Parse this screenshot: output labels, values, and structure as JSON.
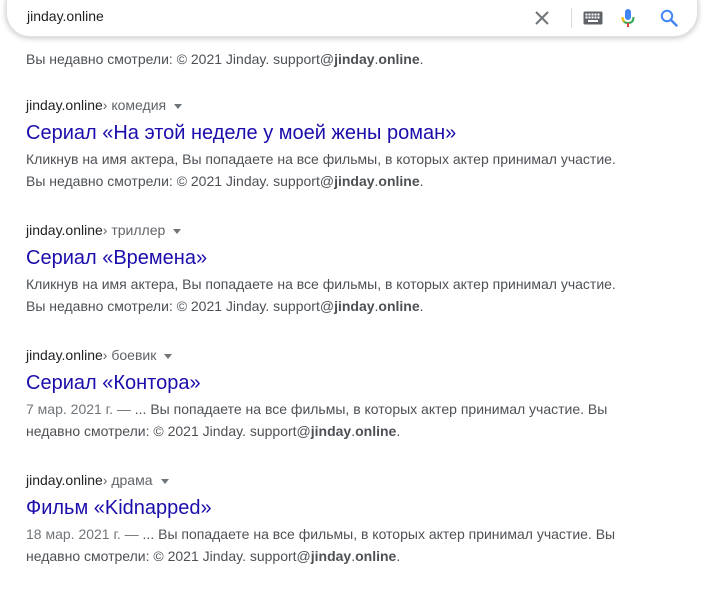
{
  "search": {
    "query": "jinday.online",
    "icons": {
      "clear": "close-icon",
      "keyboard": "keyboard-icon",
      "mic": "microphone-icon",
      "search": "search-icon"
    },
    "colors": {
      "mic_blue": "#4285f4",
      "mic_red": "#ea4335",
      "mic_yellow": "#fbbc04",
      "mic_green": "#34a853",
      "search_blue": "#4285f4"
    }
  },
  "top_snippet": {
    "prefix": "Вы недавно смотрели: © 2021 Jinday. support@",
    "bold1": "jinday",
    "dot": ".",
    "bold2": "online",
    "suffix": "."
  },
  "results": [
    {
      "domain": "jinday.online",
      "path": " › комедия",
      "title": "Сериал «На этой неделе у моей жены роман»",
      "date": "",
      "line1": "Кликнув на имя актера, Вы попадаете на все фильмы, в которых актер принимал участие.",
      "line2_prefix": "Вы недавно смотрели: © 2021 Jinday. support@",
      "bold1": "jinday",
      "dot": ".",
      "bold2": "online",
      "suffix": "."
    },
    {
      "domain": "jinday.online",
      "path": " › триллер",
      "title": "Сериал «Времена»",
      "date": "",
      "line1": "Кликнув на имя актера, Вы попадаете на все фильмы, в которых актер принимал участие.",
      "line2_prefix": "Вы недавно смотрели: © 2021 Jinday. support@",
      "bold1": "jinday",
      "dot": ".",
      "bold2": "online",
      "suffix": "."
    },
    {
      "domain": "jinday.online",
      "path": " › боевик",
      "title": "Сериал «Контора»",
      "date": "7 мар. 2021 г. — ",
      "line1": "... Вы попадаете на все фильмы, в которых актер принимал участие. Вы",
      "line2_prefix": "недавно смотрели: © 2021 Jinday. support@",
      "bold1": "jinday",
      "dot": ".",
      "bold2": "online",
      "suffix": "."
    },
    {
      "domain": "jinday.online",
      "path": " › драма",
      "title": "Фильм «Kidnapped»",
      "date": "18 мар. 2021 г. — ",
      "line1": "... Вы попадаете на все фильмы, в которых актер принимал участие. Вы",
      "line2_prefix": "недавно смотрели: © 2021 Jinday. support@",
      "bold1": "jinday",
      "dot": ".",
      "bold2": "online",
      "suffix": "."
    }
  ]
}
